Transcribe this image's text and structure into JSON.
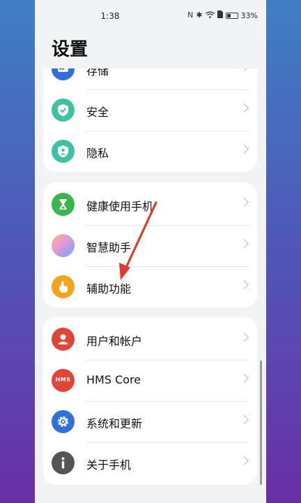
{
  "status": {
    "time": "1:38",
    "battery": "33%"
  },
  "title": "设置",
  "groups": [
    {
      "items": [
        {
          "label": "存储",
          "icon": "storage-icon",
          "color": "#2f6fe0"
        },
        {
          "label": "安全",
          "icon": "shield-check-icon",
          "color": "#3cc3a4"
        },
        {
          "label": "隐私",
          "icon": "privacy-shield-icon",
          "color": "#3cc3a4"
        }
      ]
    },
    {
      "items": [
        {
          "label": "健康使用手机",
          "icon": "hourglass-icon",
          "color": "#3ab54a"
        },
        {
          "label": "智慧助手",
          "icon": "smart-assistant-icon",
          "color": "#c9a0e8"
        },
        {
          "label": "辅助功能",
          "icon": "accessibility-hand-icon",
          "color": "#f5a31a"
        }
      ]
    },
    {
      "items": [
        {
          "label": "用户和帐户",
          "icon": "user-icon",
          "color": "#e24535"
        },
        {
          "label": "HMS Core",
          "icon": "hms-icon",
          "icon_text": "HMS",
          "color": "#e24535"
        },
        {
          "label": "系统和更新",
          "icon": "gear-icon",
          "color": "#2f6fe0"
        },
        {
          "label": "关于手机",
          "icon": "info-icon",
          "color": "#555555"
        }
      ]
    }
  ],
  "annotation": {
    "color": "#e03a2c"
  }
}
